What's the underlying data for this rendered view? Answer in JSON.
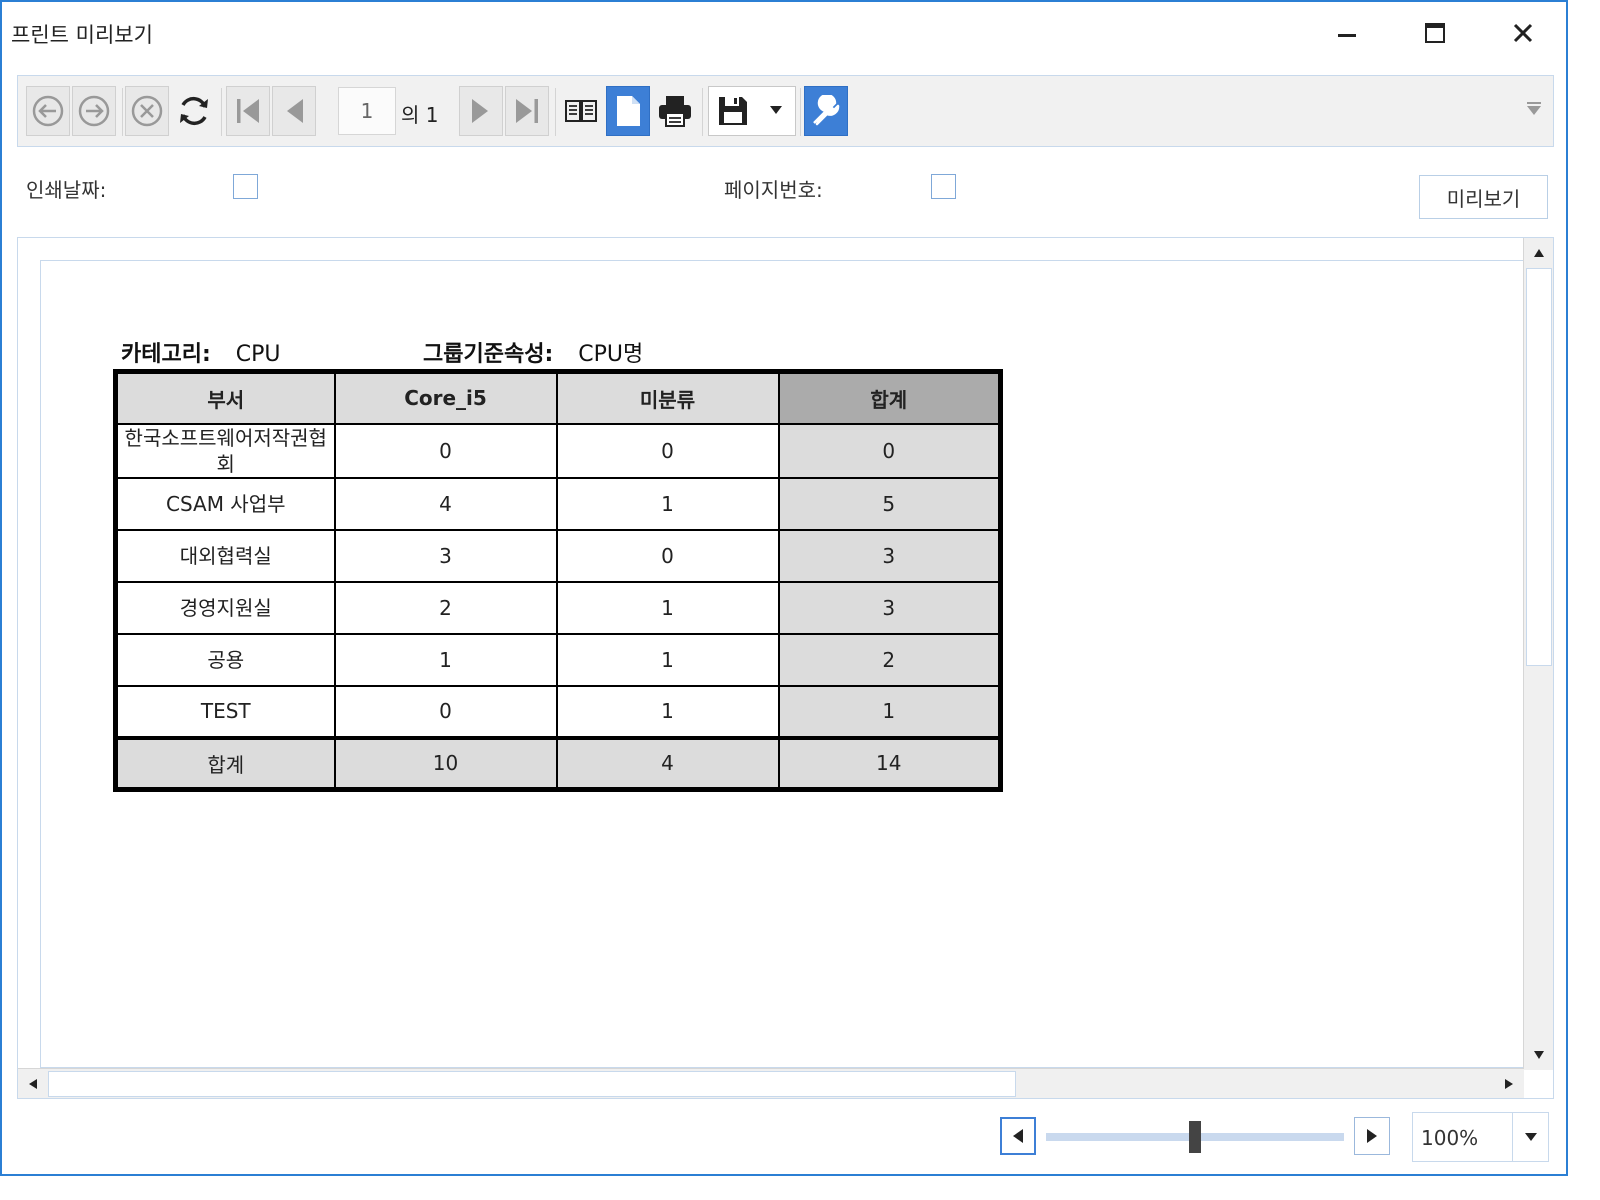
{
  "window": {
    "title": "프린트 미리보기"
  },
  "toolbar": {
    "page_current": "1",
    "page_of": "의 1"
  },
  "options": {
    "print_date_label": "인쇄날짜:",
    "page_number_label": "페이지번호:",
    "preview_button": "미리보기"
  },
  "report": {
    "category_label": "카테고리:",
    "category_value": "CPU",
    "group_label": "그룹기준속성:",
    "group_value": "CPU명",
    "headers": [
      "부서",
      "Core_i5",
      "미분류",
      "합계"
    ],
    "rows": [
      [
        "한국소프트웨어저작권협회",
        "0",
        "0",
        "0"
      ],
      [
        "CSAM 사업부",
        "4",
        "1",
        "5"
      ],
      [
        "대외협력실",
        "3",
        "0",
        "3"
      ],
      [
        "경영지원실",
        "2",
        "1",
        "3"
      ],
      [
        "공용",
        "1",
        "1",
        "2"
      ],
      [
        "TEST",
        "0",
        "1",
        "1"
      ]
    ],
    "total_row": [
      "합계",
      "10",
      "4",
      "14"
    ]
  },
  "zoom": {
    "value": "100%",
    "level_fraction": 0.5
  },
  "colors": {
    "accent": "#3d7fd6",
    "window_border": "#2b7fd4",
    "header_gray": "#dcdcdc",
    "total_header_gray": "#ababab"
  },
  "icons": [
    "back-icon",
    "forward-icon",
    "stop-icon",
    "refresh-icon",
    "first-page-icon",
    "previous-page-icon",
    "next-page-icon",
    "last-page-icon",
    "book-view-icon",
    "page-view-icon",
    "print-icon",
    "save-icon",
    "settings-wrench-icon"
  ]
}
